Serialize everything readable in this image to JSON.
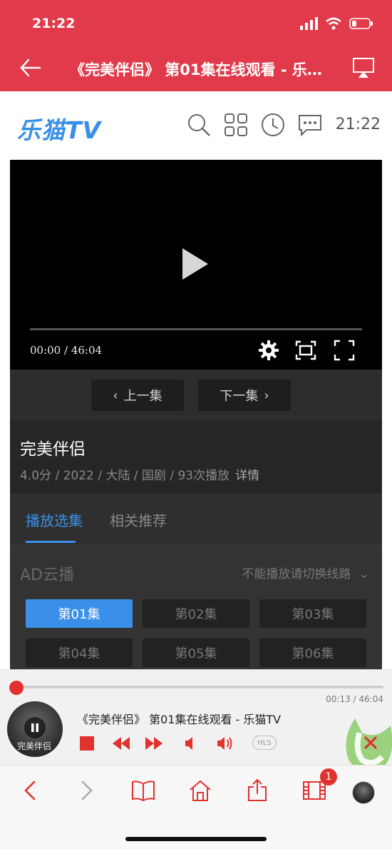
{
  "status_bar": {
    "time": "21:22"
  },
  "browser": {
    "title": "《完美伴侣》 第01集在线观看 - 乐猫TV"
  },
  "site": {
    "logo": "乐猫TV",
    "clock": "21:22"
  },
  "player": {
    "time": "00:00 / 46:04"
  },
  "episode_nav": {
    "prev": "上一集",
    "next": "下一集"
  },
  "show": {
    "title": "完美伴侣",
    "meta": "4.0分 / 2022 / 大陆 / 国剧 / 93次播放",
    "detail": "详情"
  },
  "tabs": [
    {
      "label": "播放选集"
    },
    {
      "label": "相关推荐"
    }
  ],
  "source": {
    "name": "AD云播",
    "switch_hint": "不能播放请切换线路"
  },
  "episodes": [
    {
      "label": "第01集"
    },
    {
      "label": "第02集"
    },
    {
      "label": "第03集"
    },
    {
      "label": "第04集"
    },
    {
      "label": "第05集"
    },
    {
      "label": "第06集"
    }
  ],
  "mini_player": {
    "time": "00:13 / 46:04",
    "title": "《完美伴侣》 第01集在线观看 - 乐猫TV",
    "cover_text": "完美伴侣",
    "format_badge": "HLS",
    "progress_fraction": 0.005
  },
  "toolbar": {
    "tabs_badge": "1"
  },
  "colors": {
    "accent_red": "#e03a4b",
    "accent_blue": "#3a8fe8",
    "control_red": "#e0332f"
  }
}
